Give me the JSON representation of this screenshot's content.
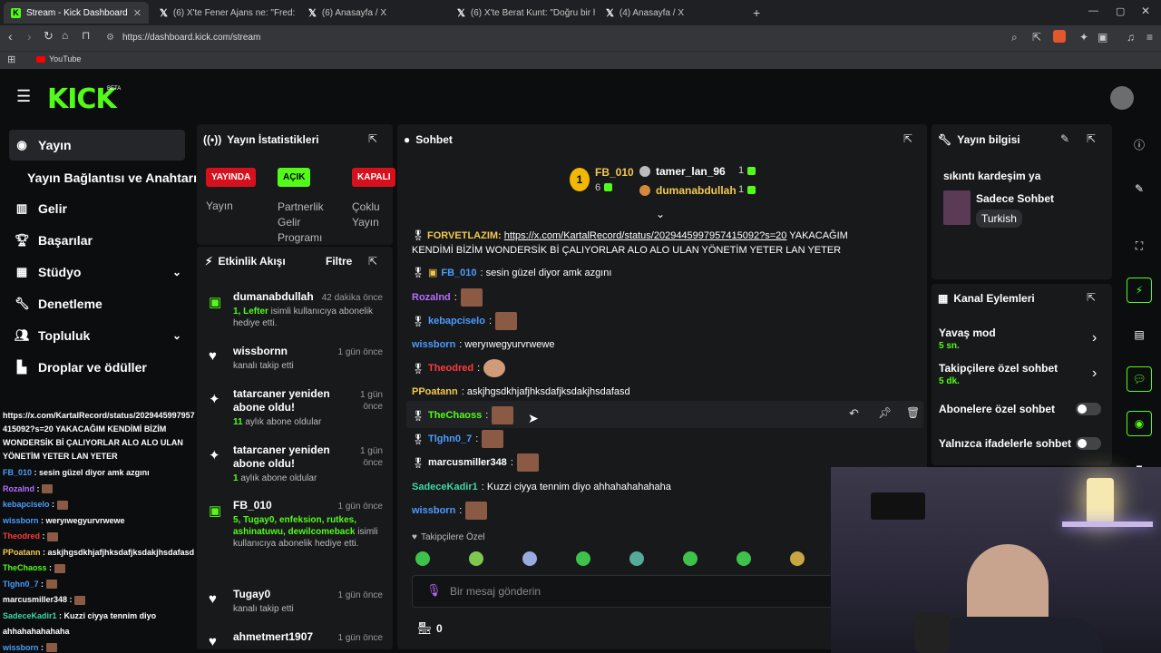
{
  "browser": {
    "tabs": [
      {
        "label": "Stream - Kick Dashboard",
        "active": true
      },
      {
        "label": "(6) X'te Fener Ajans ne: \"Fred: \"Sizin"
      },
      {
        "label": "(6) Anasayfa / X"
      },
      {
        "label": "(6) X'te Berat Kunt: \"Doğru bir hamle"
      },
      {
        "label": "(4) Anasayfa / X"
      }
    ],
    "url": "https://dashboard.kick.com/stream",
    "bookmark": "YouTube"
  },
  "logo": {
    "text": "KICK",
    "badge": "BETA"
  },
  "sidebar": {
    "items": [
      {
        "label": "Yayın",
        "icon": "broadcast-icon"
      },
      {
        "label": "Yayın Bağlantısı ve Anahtarı"
      },
      {
        "label": "Gelir",
        "icon": "chart-icon"
      },
      {
        "label": "Başarılar",
        "icon": "trophy-icon"
      },
      {
        "label": "Stüdyo",
        "icon": "studio-icon"
      },
      {
        "label": "Denetleme",
        "icon": "wrench-icon"
      },
      {
        "label": "Topluluk",
        "icon": "people-icon"
      },
      {
        "label": "Droplar ve ödüller",
        "icon": "drops-icon"
      }
    ]
  },
  "stats": {
    "title": "Yayın İstatistikleri",
    "badges": [
      {
        "text": "YAYINDA",
        "label": "Yayın",
        "color": "#d4111c"
      },
      {
        "text": "AÇIK",
        "label": "Partnerlik Gelir Programı",
        "color": "#53fc18"
      },
      {
        "text": "KAPALI",
        "label": "Çoklu Yayın",
        "color": "#d4111c"
      }
    ]
  },
  "activity": {
    "title": "Etkinlik Akışı",
    "filter": "Filtre",
    "events": [
      {
        "name": "dumanabdullah",
        "time": "42 dakika önce",
        "sub_green": "1, Lefter",
        "sub": " isimli kullanıcıya abonelik hediye etti.",
        "icon": "gift-icon"
      },
      {
        "name": "wissbornn",
        "time": "1 gün önce",
        "sub": "kanalı takip etti",
        "icon": "heart-icon"
      },
      {
        "name": "tatarcaner yeniden abone oldu!",
        "time": "1 gün önce",
        "sub_green": "11",
        "sub": " aylık abone oldular",
        "icon": "sparkle-icon"
      },
      {
        "name": "tatarcaner yeniden abone oldu!",
        "time": "1 gün önce",
        "sub_green": "1",
        "sub": " aylık abone oldular",
        "icon": "sparkle-icon"
      },
      {
        "name": "FB_010",
        "time": "1 gün önce",
        "sub_green": "5, Tugay0, enfeksion, rutkes, ashinatuwu, dewilcomeback",
        "sub": " isimli kullanıcıya abonelik hediye etti.",
        "icon": "gift-icon"
      },
      {
        "name": "Tugay0",
        "time": "1 gün önce",
        "sub": "kanalı takip etti",
        "icon": "heart-icon"
      },
      {
        "name": "ahmetmert1907",
        "time": "1 gün önce",
        "sub": "",
        "icon": "heart-icon"
      }
    ]
  },
  "chat": {
    "title": "Sohbet",
    "leaders": [
      {
        "name": "FB_010",
        "count": "6"
      },
      {
        "name": "tamer_lan_96",
        "count": "1"
      },
      {
        "name": "dumanabdullah",
        "count": "1"
      }
    ],
    "messages": [
      {
        "user": "FORVETLAZIM:",
        "color": "#f2c94c",
        "link": "https://x.com/KartalRecord/status/2029445997957415092?s=20",
        "text": " YAKACAĞIM",
        "text2": "KENDİMİ BİZİM WONDERSİK Bİ ÇALIYORLAR ALO ALO ULAN YÖNETİM YETER LAN YETER"
      },
      {
        "user": "FB_010",
        "color": "#4b9cff",
        "text": ": sesin güzel diyor amk azgını"
      },
      {
        "user": "Rozalnd",
        "color": "#b66dff",
        "text": ":"
      },
      {
        "user": "kebapciselo",
        "color": "#4b9cff",
        "text": ":"
      },
      {
        "user": "wissborn",
        "color": "#4b9cff",
        "text": ": weryıwegyurvrwewe"
      },
      {
        "user": "Theodred",
        "color": "#ff3b3b",
        "text": ":"
      },
      {
        "user": "PPoatann",
        "color": "#f2c94c",
        "text": ": askjhgsdkhjafjhksdafjksdakjhsdafasd"
      },
      {
        "user": "TheChaoss",
        "color": "#53fc18",
        "text": ":"
      },
      {
        "user": "Tlghn0_7",
        "color": "#4b9cff",
        "text": ":"
      },
      {
        "user": "marcusmiller348",
        "color": "#ffffff",
        "text": ":"
      },
      {
        "user": "SadeceKadir1",
        "color": "#3ed8a6",
        "text": ": Kuzzi ciyya tennim diyo ahhahahahahaha"
      },
      {
        "user": "wissborn",
        "color": "#4b9cff",
        "text": ":"
      }
    ],
    "followers_only": "Takipçilere Özel",
    "input_placeholder": "Bir mesaj gönderin",
    "store_count": "0"
  },
  "overlay": {
    "lines": [
      "https://x.com/KartalRecord/status/2029445997957",
      "415092?s=20 YAKACAĞIM KENDİMİ BİZİM",
      "WONDERSİK Bİ ÇALIYORLAR ALO ALO ULAN",
      "YÖNETİM YETER LAN YETER"
    ],
    "chat": [
      {
        "user": "FB_010",
        "text": " : sesin güzel diyor amk azgını",
        "color": "#4b9cff"
      },
      {
        "user": "Rozalnd",
        "text": " :",
        "color": "#b66dff"
      },
      {
        "user": "kebapciselo",
        "text": " :",
        "color": "#4b9cff"
      },
      {
        "user": "wissborn",
        "text": " : weryıwegyurvrwewe",
        "color": "#4b9cff"
      },
      {
        "user": "Theodred",
        "text": " :",
        "color": "#ff3b3b"
      },
      {
        "user": "PPoatann",
        "text": " : askjhgsdkhjafjhksdafjksdakjhsdafasd",
        "color": "#f2c94c"
      },
      {
        "user": "TheChaoss",
        "text": " :",
        "color": "#53fc18"
      },
      {
        "user": "Tlghn0_7",
        "text": " :",
        "color": "#4b9cff"
      },
      {
        "user": "marcusmiller348",
        "text": " :",
        "color": "#ffffff"
      },
      {
        "user": "SadeceKadir1",
        "text": " : Kuzzi ciyya tennim diyo",
        "color": "#3ed8a6"
      },
      {
        "user": "",
        "text": "ahhahahahahaha",
        "color": "#ffffff"
      },
      {
        "user": "wissborn",
        "text": " :",
        "color": "#4b9cff"
      }
    ]
  },
  "stream_info": {
    "title": "Yayın bilgisi",
    "stream_title": "sıkıntı kardeşim ya",
    "category": "Sadece Sohbet",
    "tag": "Turkish"
  },
  "channel_actions": {
    "title": "Kanal Eylemleri",
    "items": [
      {
        "label": "Yavaş mod",
        "value": "5 sn."
      },
      {
        "label": "Takipçilere özel sohbet",
        "value": "5 dk."
      },
      {
        "label": "Abonelere özel sohbet"
      },
      {
        "label": "Yalnızca ifadelerle sohbet"
      }
    ]
  }
}
